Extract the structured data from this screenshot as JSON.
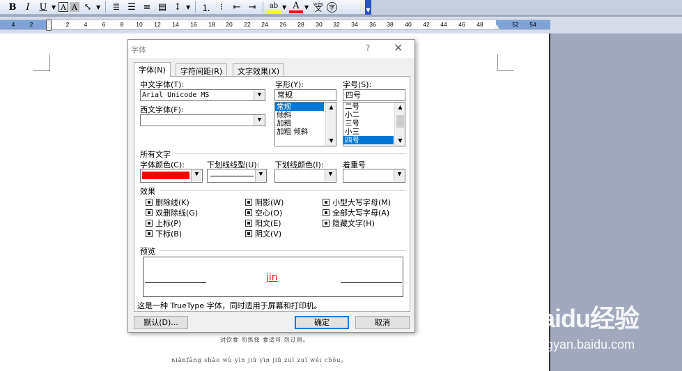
{
  "toolbar": {
    "bold": "B",
    "italic": "I",
    "underline": "U",
    "font_box": "A",
    "highlight_a": "A",
    "pinyin_top": "wén",
    "pinyin_char": "文",
    "circle_char": "字",
    "colors": {
      "highlight": "#ffff00",
      "font": "#ff0000",
      "accent": "#2455c3"
    }
  },
  "ruler": {
    "numbers": [
      "4",
      "2",
      "2",
      "4",
      "6",
      "8",
      "10",
      "12",
      "14",
      "16",
      "18",
      "20",
      "22",
      "24",
      "26",
      "28",
      "30",
      "32",
      "34",
      "36",
      "38",
      "40",
      "42",
      "44",
      "46",
      "48",
      "52",
      "54"
    ]
  },
  "document": {
    "line1": "对饮食   勿拣择   食适可   勿过则。",
    "line2": "niǎnfāng shào wù yìn jiǔ    yìn jiǔ zuì    zuì wéi chǒu。"
  },
  "dialog": {
    "title": "字体",
    "help": "?",
    "close": "✕",
    "tabs": [
      "字体(N)",
      "字符间距(R)",
      "文字效果(X)"
    ],
    "chinese_font_label": "中文字体(T):",
    "chinese_font_value": "Arial Unicode MS",
    "western_font_label": "西文字体(F):",
    "western_font_value": "",
    "style_label": "字形(Y):",
    "style_value": "常规",
    "style_options": [
      "常规",
      "倾斜",
      "加粗",
      "加粗 倾斜"
    ],
    "style_selected": "常规",
    "size_label": "字号(S):",
    "size_value": "四号",
    "size_options": [
      "二号",
      "小二",
      "三号",
      "小三",
      "四号"
    ],
    "size_selected": "四号",
    "all_text_label": "所有文字",
    "font_color_label": "字体颜色(C):",
    "font_color": "#ff0000",
    "underline_style_label": "下划线线型(U):",
    "underline_color_label": "下划线颜色(I):",
    "emphasis_label": "着重号",
    "effects_label": "效果",
    "effects": [
      "删除线(K)",
      "双删除线(G)",
      "上标(P)",
      "下标(B)",
      "阴影(W)",
      "空心(O)",
      "阳文(E)",
      "阴文(V)",
      "小型大写字母(M)",
      "全部大写字母(A)",
      "隐藏文字(H)"
    ],
    "preview_label": "预览",
    "preview_text": "jin",
    "description": "这是一种 TrueType 字体，同时适用于屏幕和打印机。",
    "default_button": "默认(D)...",
    "ok_button": "确定",
    "cancel_button": "取消"
  },
  "watermark": {
    "brand": "Baidu经验",
    "url": "jingyan.baidu.com"
  }
}
